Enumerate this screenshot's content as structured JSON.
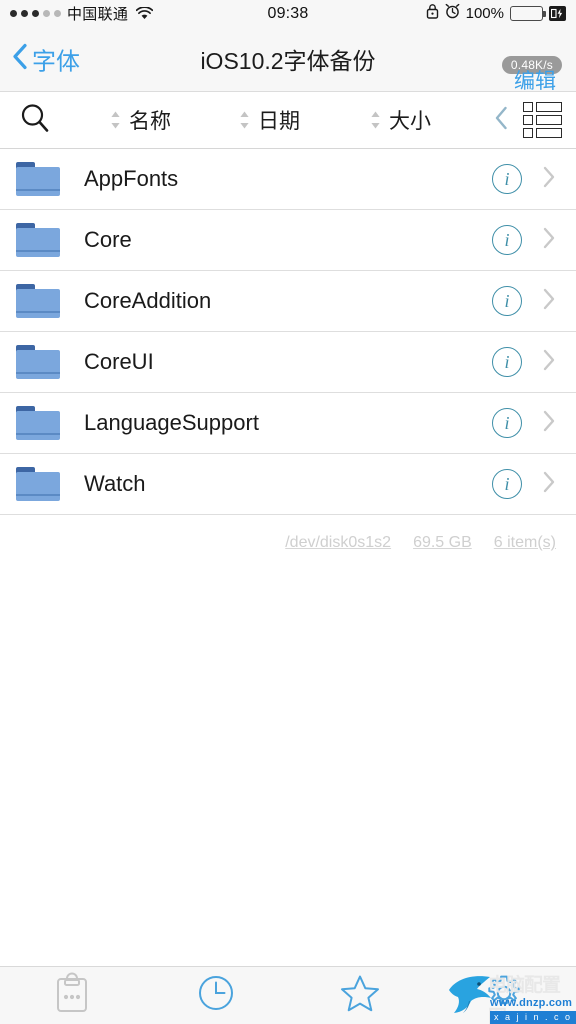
{
  "status_bar": {
    "signal_dots_filled": 3,
    "signal_dots_total": 5,
    "carrier": "中国联通",
    "wifi_icon": "wifi-icon",
    "time": "09:38",
    "lock_icon": "lock-icon",
    "alarm_icon": "alarm-clock-icon",
    "battery_percent": "100%",
    "battery_icon": "battery-full-icon",
    "charging_icon": "charging-bolt-icon"
  },
  "nav_bar": {
    "back_icon": "chevron-left-icon",
    "back_label": "字体",
    "title": "iOS10.2字体备份",
    "edit_label": "编辑",
    "network_speed": "0.48K/s"
  },
  "toolbar": {
    "search_icon": "search-icon",
    "sort_options": [
      {
        "label": "名称",
        "icon": "sort-updown-icon"
      },
      {
        "label": "日期",
        "icon": "sort-updown-icon"
      },
      {
        "label": "大小",
        "icon": "sort-updown-icon"
      }
    ],
    "collapse_icon": "chevron-left-icon",
    "view_toggle_icon": "list-view-icon"
  },
  "file_list": {
    "items": [
      {
        "name": "AppFonts",
        "icon": "folder-icon",
        "info_icon": "info-circle-icon",
        "disclosure_icon": "chevron-right-icon"
      },
      {
        "name": "Core",
        "icon": "folder-icon",
        "info_icon": "info-circle-icon",
        "disclosure_icon": "chevron-right-icon"
      },
      {
        "name": "CoreAddition",
        "icon": "folder-icon",
        "info_icon": "info-circle-icon",
        "disclosure_icon": "chevron-right-icon"
      },
      {
        "name": "CoreUI",
        "icon": "folder-icon",
        "info_icon": "info-circle-icon",
        "disclosure_icon": "chevron-right-icon"
      },
      {
        "name": "LanguageSupport",
        "icon": "folder-icon",
        "info_icon": "info-circle-icon",
        "disclosure_icon": "chevron-right-icon"
      },
      {
        "name": "Watch",
        "icon": "folder-icon",
        "info_icon": "info-circle-icon",
        "disclosure_icon": "chevron-right-icon"
      }
    ]
  },
  "footer": {
    "device": "/dev/disk0s1s2",
    "capacity": "69.5 GB",
    "item_count": "6 item(s)"
  },
  "tab_bar": {
    "tabs": [
      {
        "icon": "clipboard-icon",
        "name": "clipboard-tab",
        "enabled": false
      },
      {
        "icon": "clock-icon",
        "name": "recents-tab",
        "enabled": true
      },
      {
        "icon": "star-icon",
        "name": "favorites-tab",
        "enabled": true
      },
      {
        "icon": "gear-icon",
        "name": "settings-tab",
        "enabled": true
      }
    ]
  },
  "watermark": {
    "logo_icon": "shark-logo-icon",
    "title": "电脑配置网",
    "url": "www.dnzp.com",
    "sub": "x a j i n . c o m"
  },
  "colors": {
    "accent_blue": "#3ca0e8",
    "folder_blue": "#7ba7dd",
    "folder_tab": "#3d66a4",
    "info_teal": "#3f8fa8",
    "battery_green": "#4cd562",
    "bar_bg": "#f7f7f7",
    "footer_gray": "#cfcfcf"
  }
}
